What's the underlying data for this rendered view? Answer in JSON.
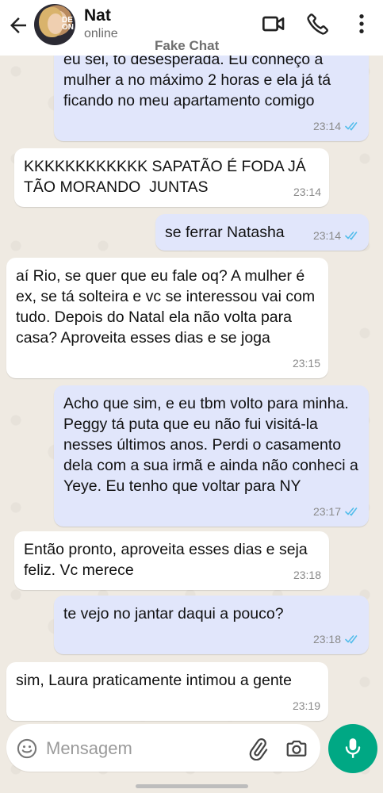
{
  "header": {
    "contact_name": "Nat",
    "status": "online",
    "watermark": "Fake Chat",
    "avatar_text": "DE\nON"
  },
  "icons": {
    "back": "arrow-left-icon",
    "video": "video-camera-icon",
    "call": "phone-icon",
    "menu": "more-vertical-icon",
    "emoji": "emoji-icon",
    "attach": "paperclip-icon",
    "camera": "camera-icon",
    "mic": "microphone-icon"
  },
  "colors": {
    "outgoing_bubble": "#e1e6fb",
    "incoming_bubble": "#ffffff",
    "read_ticks": "#53bdeb",
    "mic_button": "#00a884"
  },
  "messages": [
    {
      "direction": "out",
      "text": "eu sei, tô desesperada. Eu conheço a mulher a no máximo 2 horas e ela já tá ficando no meu apartamento comigo",
      "time": "23:14",
      "read": true
    },
    {
      "direction": "in",
      "text": "KKKKKKKKKKKK SAPATÃO É FODA JÁ TÃO MORANDO  JUNTAS",
      "time": "23:14"
    },
    {
      "direction": "out",
      "text": "se ferrar Natasha",
      "time": "23:14",
      "read": true
    },
    {
      "direction": "in",
      "text": "aí Rio, se quer que eu fale oq? A mulher é ex, se tá solteira e vc se interessou vai com tudo. Depois do Natal ela não volta para casa? Aproveita esses dias e se joga",
      "time": "23:15"
    },
    {
      "direction": "out",
      "text": "Acho que sim, e eu tbm volto para minha. Peggy tá puta que eu não fui visitá-la nesses últimos anos. Perdi o casamento dela com a sua irmã e ainda não conheci a Yeye. Eu tenho que voltar para NY",
      "time": "23:17",
      "read": true
    },
    {
      "direction": "in",
      "text": "Então pronto, aproveita esses dias e seja feliz. Vc merece",
      "time": "23:18"
    },
    {
      "direction": "out",
      "text": "te vejo no jantar daqui a pouco?",
      "time": "23:18",
      "read": true
    },
    {
      "direction": "in",
      "text": "sim, Laura praticamente intimou a gente",
      "time": "23:19"
    }
  ],
  "composer": {
    "placeholder": "Mensagem",
    "value": ""
  }
}
